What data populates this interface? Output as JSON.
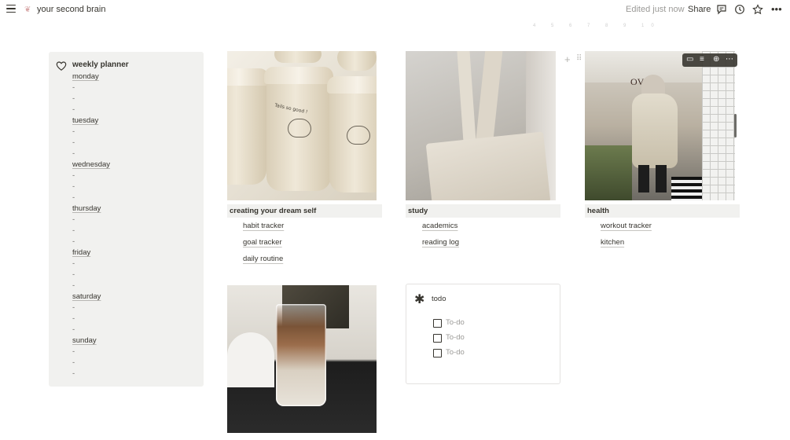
{
  "topbar": {
    "page_title": "your second brain",
    "page_icon": "heart-doodle-icon",
    "edited": "Edited just now",
    "share_label": "Share",
    "icons": [
      "menu-icon",
      "comment-icon",
      "history-icon",
      "star-icon",
      "more-icon"
    ],
    "page_numbers": "4 5 6 7 8 9 10"
  },
  "planner": {
    "title": "weekly planner",
    "icon": "heart-icon",
    "items": [
      "monday",
      "-",
      "-",
      "-",
      "tuesday",
      "-",
      "-",
      "-",
      "wednesday",
      "-",
      "-",
      "-",
      "thursday",
      "-",
      "-",
      "-",
      "friday",
      "-",
      "-",
      "-",
      "saturday",
      "-",
      "-",
      "-",
      "sunday",
      "-",
      "-",
      "-"
    ]
  },
  "columns": [
    {
      "header": "creating your dream self",
      "links": [
        "habit tracker",
        "goal tracker",
        "daily routine"
      ]
    },
    {
      "header": "study",
      "links": [
        "academics",
        "reading log"
      ]
    },
    {
      "header": "health",
      "links": [
        "workout tracker",
        "kitchen"
      ]
    }
  ],
  "image_text": {
    "cup_label": "Tails so good !",
    "poster_text": "OVE"
  },
  "todo": {
    "icon": "asterisk-icon",
    "title": "todo",
    "items": [
      {
        "label": "To-do",
        "checked": false
      },
      {
        "label": "To-do",
        "checked": false
      },
      {
        "label": "To-do",
        "checked": false
      }
    ]
  },
  "colors": {
    "panel_bg": "#f1f1ef",
    "text": "#37352f",
    "muted": "#9b9a97",
    "toolbar_bg": "#37352f"
  }
}
